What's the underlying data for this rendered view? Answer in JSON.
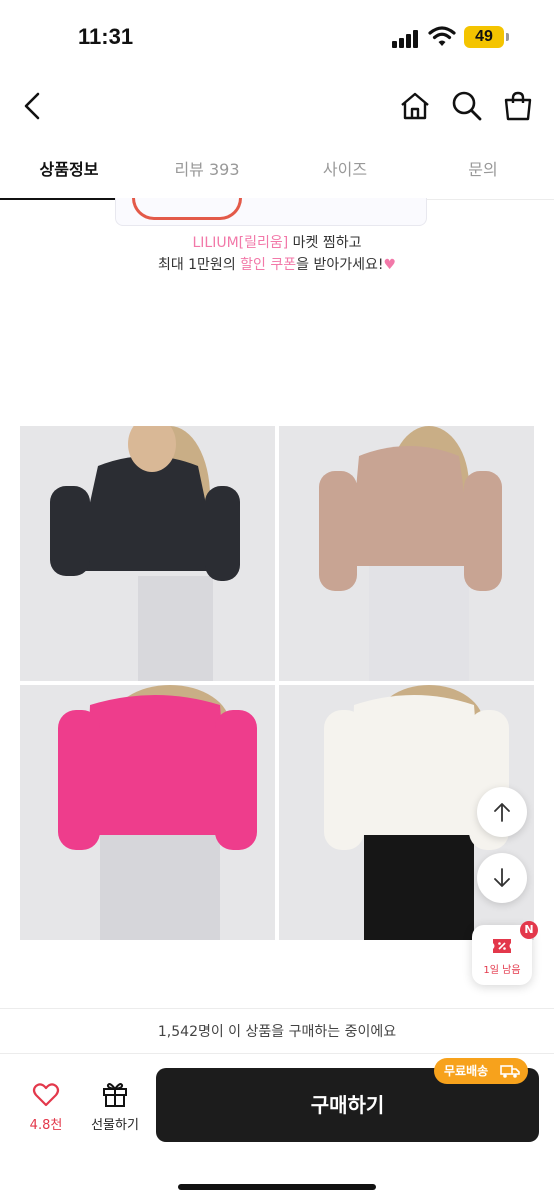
{
  "status": {
    "time": "11:31",
    "battery": "49"
  },
  "tabs": [
    {
      "label": "상품정보",
      "active": true
    },
    {
      "label": "리뷰 393",
      "active": false
    },
    {
      "label": "사이즈",
      "active": false
    },
    {
      "label": "문의",
      "active": false
    }
  ],
  "coupon": {
    "brand": "LILIUM[릴리움]",
    "line1_rest": " 마켓 찜하고",
    "line2_a": "최대 1만원의 ",
    "line2_highlight": "할인 쿠폰",
    "line2_b": "을 받아가세요!",
    "heart": "♥"
  },
  "products": [
    {
      "color": "#2b2d33",
      "name": "black-cardigan"
    },
    {
      "color": "#c8a493",
      "name": "beige-cardigan"
    },
    {
      "color": "#ee3d8c",
      "name": "pink-cardigan"
    },
    {
      "color": "#f5f3ee",
      "name": "white-cardigan"
    }
  ],
  "float": {
    "coupon_caption": "1일 남음",
    "badge": "N"
  },
  "buying_text": "1,542명이 이 상품을 구매하는 중이에요",
  "bottom": {
    "likes": "4.8천",
    "gift_label": "선물하기",
    "buy_label": "구매하기",
    "free_shipping": "무료배송"
  },
  "colors": {
    "accent_red": "#e3384b",
    "brand_pink": "#f279a9",
    "shipping_orange": "#f7a21c"
  }
}
